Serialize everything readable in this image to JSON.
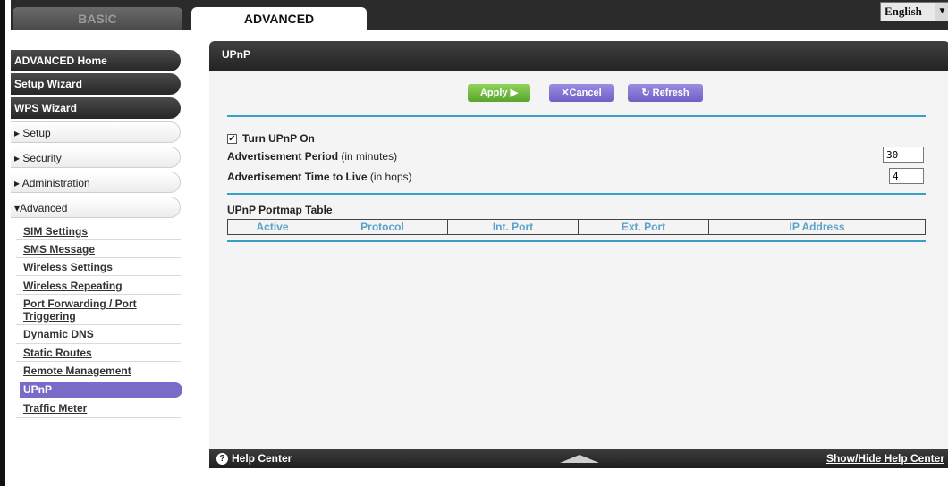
{
  "tabs": {
    "basic": "BASIC",
    "advanced": "ADVANCED"
  },
  "language": {
    "selected": "English",
    "arrow": "▼"
  },
  "sidebar": {
    "advanced_home": "ADVANCED Home",
    "setup_wizard": "Setup Wizard",
    "wps_wizard": "WPS Wizard",
    "setup": "▸ Setup",
    "security": "▸ Security",
    "administration": "▸ Administration",
    "advanced": "▾Advanced",
    "submenu": [
      "SIM Settings",
      "SMS Message",
      "Wireless Settings",
      "Wireless Repeating",
      "Port Forwarding / Port Triggering",
      "Dynamic DNS",
      "Static Routes",
      "Remote Management",
      "UPnP",
      "Traffic Meter"
    ]
  },
  "panel": {
    "title": "UPnP",
    "buttons": {
      "apply": "Apply ▶",
      "cancel": "✕Cancel",
      "refresh": "↻ Refresh"
    },
    "turn_upnp_on": "Turn UPnP On",
    "turn_upnp_on_checked": true,
    "adv_period_label": "Advertisement Period",
    "adv_period_unit": "(in minutes)",
    "adv_period_value": "30",
    "adv_ttl_label": "Advertisement Time to Live",
    "adv_ttl_unit": "(in hops)",
    "adv_ttl_value": "4",
    "portmap_title": "UPnP Portmap Table",
    "portmap_columns": [
      "Active",
      "Protocol",
      "Int. Port",
      "Ext. Port",
      "IP Address"
    ]
  },
  "footer": {
    "help_center": "Help Center",
    "show_hide": "Show/Hide Help Center"
  },
  "colors": {
    "accent_purple": "#7a6bc7",
    "apply_green": "#6cb83a",
    "rule_blue": "#3a9fc6",
    "header_dark": "#2b2b2b"
  }
}
